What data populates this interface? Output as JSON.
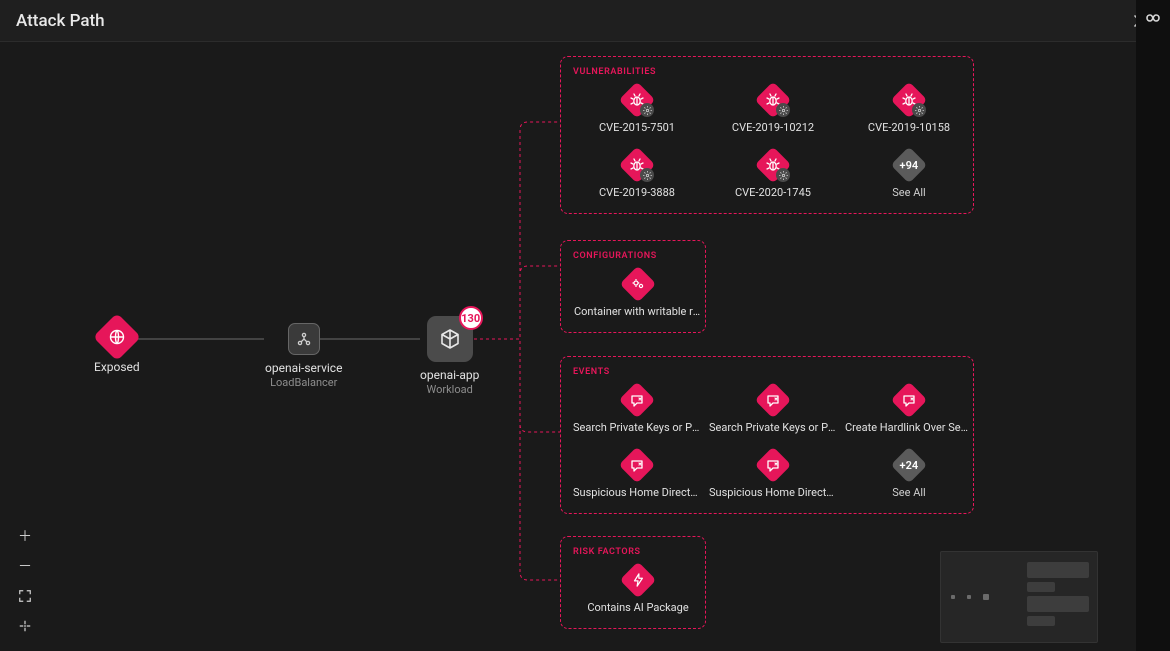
{
  "header": {
    "title": "Attack Path"
  },
  "graph": {
    "nodes": {
      "exposed": {
        "label": "Exposed"
      },
      "service": {
        "label": "openai-service",
        "sublabel": "LoadBalancer"
      },
      "app": {
        "label": "openai-app",
        "sublabel": "Workload",
        "badge": "130"
      }
    }
  },
  "groups": {
    "vulnerabilities": {
      "title": "Vulnerabilities",
      "items": [
        {
          "label": "CVE-2015-7501"
        },
        {
          "label": "CVE-2019-10212"
        },
        {
          "label": "CVE-2019-10158"
        },
        {
          "label": "CVE-2019-3888"
        },
        {
          "label": "CVE-2020-1745"
        }
      ],
      "more": "+94",
      "see_all": "See All"
    },
    "configurations": {
      "title": "Configurations",
      "items": [
        {
          "label": "Container with writable ro..."
        }
      ]
    },
    "events": {
      "title": "Events",
      "items": [
        {
          "label": "Search Private Keys or Pa..."
        },
        {
          "label": "Search Private Keys or Pa..."
        },
        {
          "label": "Create Hardlink Over Sen..."
        },
        {
          "label": "Suspicious Home Directo..."
        },
        {
          "label": "Suspicious Home Directo..."
        }
      ],
      "more": "+24",
      "see_all": "See All"
    },
    "risk_factors": {
      "title": "Risk Factors",
      "items": [
        {
          "label": "Contains AI Package"
        }
      ]
    }
  }
}
